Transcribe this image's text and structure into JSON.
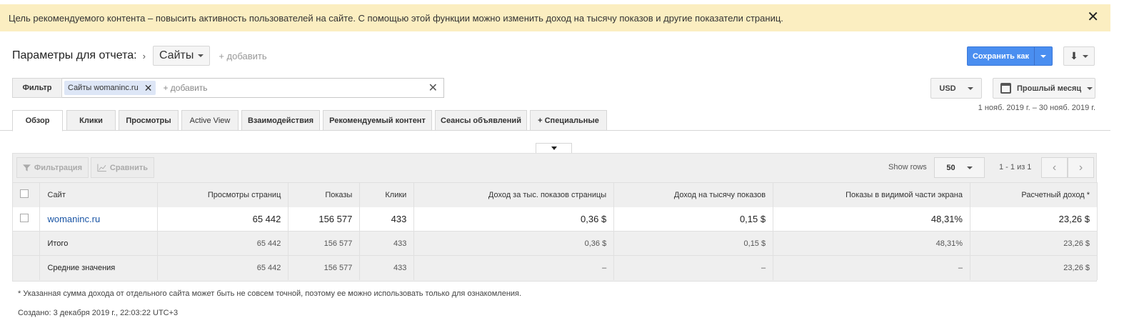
{
  "banner": {
    "text": "Цель рекомендуемого контента – повысить активность пользователей на сайте. С помощью этой функции можно изменить доход на тысячу показов и другие показатели страниц.",
    "close": "✕"
  },
  "params": {
    "label": "Параметры для отчета:",
    "chevron": "›",
    "dimension": "Сайты",
    "add": "+ добавить"
  },
  "actions": {
    "save_label": "Сохранить как",
    "download_icon": "⬇"
  },
  "filter": {
    "button": "Фильтр",
    "chip": "Сайты womaninc.ru",
    "chip_remove": "✕",
    "add": "+ добавить",
    "clear": "✕"
  },
  "currency": "USD",
  "period": "Прошлый месяц",
  "date_range": "1 нояб. 2019 г. – 30 нояб. 2019 г.",
  "tabs": [
    {
      "label": "Обзор"
    },
    {
      "label": "Клики"
    },
    {
      "label": "Просмотры"
    },
    {
      "label": "Active View"
    },
    {
      "label": "Взаимодействия"
    },
    {
      "label": "Рекомендуемый контент"
    },
    {
      "label": "Сеансы объявлений"
    },
    {
      "label": "+  Специальные"
    }
  ],
  "toolbar": {
    "filter": "Фильтрация",
    "compare": "Сравнить",
    "show_rows": "Show rows",
    "rows_value": "50",
    "pager": "1 - 1 из 1",
    "prev": "‹",
    "next": "›"
  },
  "table": {
    "headers": [
      "Сайт",
      "Просмотры страниц",
      "Показы",
      "Клики",
      "Доход за тыс. показов страницы",
      "Доход на тысячу показов",
      "Показы в видимой части экрана",
      "Расчетный доход *"
    ],
    "rows": [
      [
        "womaninc.ru",
        "65 442",
        "156 577",
        "433",
        "0,36 $",
        "0,15 $",
        "48,31%",
        "23,26 $"
      ]
    ],
    "total": [
      "Итого",
      "65 442",
      "156 577",
      "433",
      "0,36 $",
      "0,15 $",
      "48,31%",
      "23,26 $"
    ],
    "average": [
      "Средние значения",
      "65 442",
      "156 577",
      "433",
      "–",
      "–",
      "–",
      "23,26 $"
    ]
  },
  "footnote": "* Указанная сумма дохода от отдельного сайта может быть не совсем точной, поэтому ее можно использовать только для ознакомления.",
  "created": "Создано: 3 декабря 2019 г., 22:03:22 UTC+3"
}
